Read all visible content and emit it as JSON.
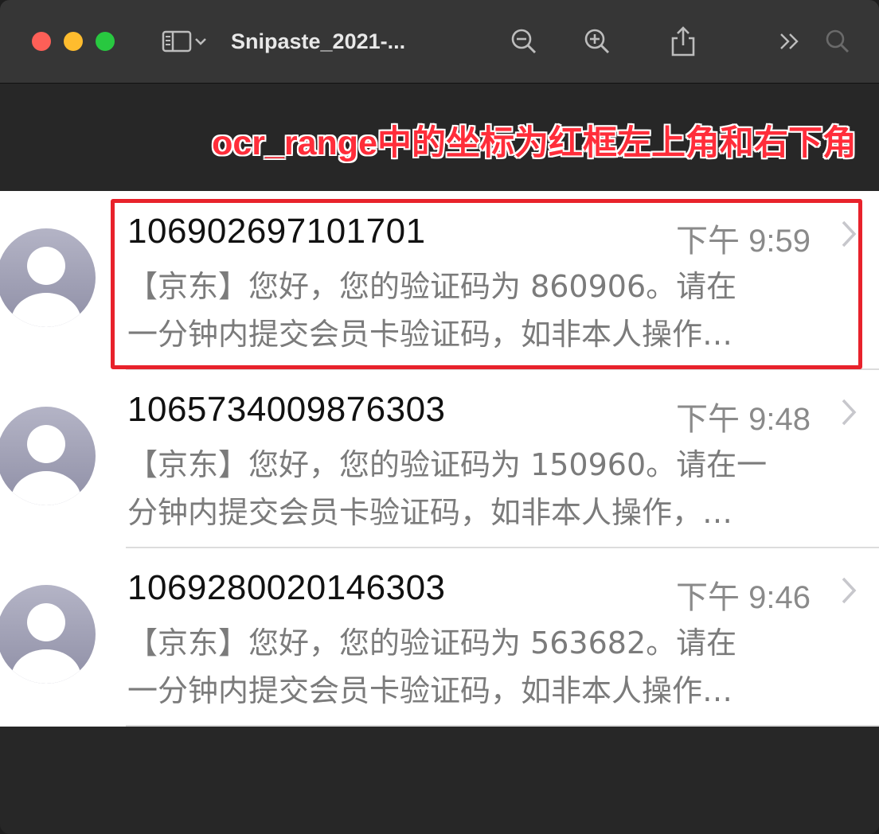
{
  "window": {
    "title": "Snipaste_2021-...",
    "annotation": "ocr_range中的坐标为红框左上角和右下角"
  },
  "toolbar": {
    "icons": [
      "sidebar-icon",
      "chevron-down-icon",
      "zoom-out-icon",
      "zoom-in-icon",
      "share-icon",
      "more-icon",
      "search-icon"
    ]
  },
  "messages": [
    {
      "sender": "106902697101701",
      "time": "下午 9:59",
      "line1": "【京东】您好，您的验证码为 860906。请在",
      "line2": "一分钟内提交会员卡验证码，如非本人操作…"
    },
    {
      "sender": "1065734009876303",
      "time": "下午 9:48",
      "line1": "【京东】您好，您的验证码为 150960。请在一",
      "line2": "分钟内提交会员卡验证码，如非本人操作，…"
    },
    {
      "sender": "1069280020146303",
      "time": "下午 9:46",
      "line1": "【京东】您好，您的验证码为 563682。请在",
      "line2": "一分钟内提交会员卡验证码，如非本人操作…"
    }
  ],
  "colors": {
    "highlight": "#e8222b",
    "annotation": "#ff2d3a",
    "avatar": "#a4a4b8"
  }
}
